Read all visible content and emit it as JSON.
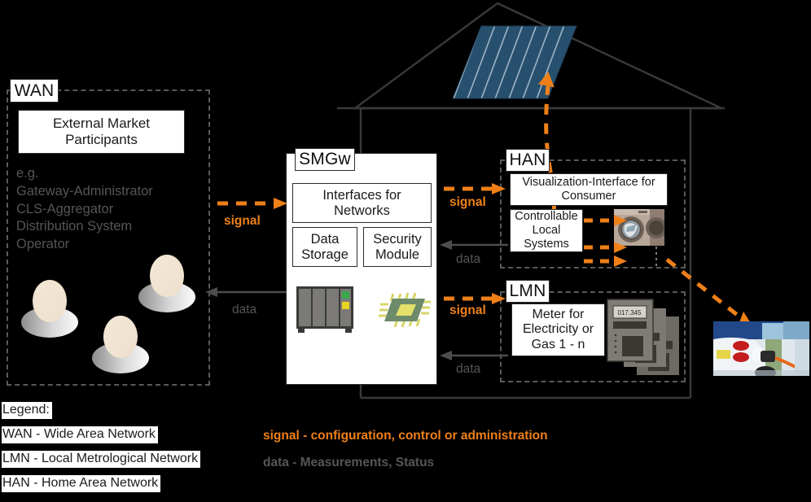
{
  "diagram": {
    "title": "Smart Meter Gateway Network Architecture",
    "colors": {
      "signal_orange": "#ef8018",
      "data_grey": "#575554",
      "background": "#000000",
      "box_fill": "#ffffff",
      "zone_dash": "#5a5a58",
      "solar_panel": "#27506e",
      "chip_body": "#6d8a6b",
      "chip_core": "#e4e06a",
      "server_body": "#7c7a78"
    }
  },
  "wan": {
    "tag": "WAN",
    "main_box": "External Market\nParticipants",
    "main_box_line1": "External Market",
    "main_box_line2": "Participants",
    "examples_lead": "e.g.",
    "examples": [
      "Gateway-Administrator",
      "CLS-Aggregator",
      "Distribution System",
      "Operator"
    ],
    "actors_icon": "person-group-icon"
  },
  "smgw": {
    "tag": "SMGw",
    "interfaces_line1": "Interfaces for",
    "interfaces_line2": "Networks",
    "data_storage_line1": "Data",
    "data_storage_line2": "Storage",
    "security_module_line1": "Security",
    "security_module_line2": "Module",
    "server_icon": "server-rack-icon",
    "chip_icon": "security-chip-icon"
  },
  "han": {
    "tag": "HAN",
    "visualization_line1": "Visualization-Interface for",
    "visualization_line2": "Consumer",
    "controllable_line1": "Controllable",
    "controllable_line2": "Local",
    "controllable_line3": "Systems",
    "appliance_icon": "washing-machine-photo"
  },
  "lmn": {
    "tag": "LMN",
    "meter_line1": "Meter for",
    "meter_line2": "Electricity or",
    "meter_line3": "Gas 1 - n",
    "meter_reading": "017.345",
    "meter_icon": "meter-stack-icon"
  },
  "house": {
    "solar_panel_icon": "solar-panel-icon",
    "ev_icon": "electric-vehicle-charging-photo"
  },
  "arrows": {
    "wan_to_smgw_signal": "signal",
    "smgw_to_wan_data": "data",
    "smgw_to_han_signal": "signal",
    "han_to_smgw_data": "data",
    "smgw_to_lmn_signal": "signal",
    "lmn_to_smgw_data": "data"
  },
  "legend": {
    "title": "Legend:",
    "entries": [
      "WAN - Wide Area Network",
      "LMN - Local Metrological Network",
      "HAN - Home Area Network"
    ]
  },
  "key": {
    "signal": "signal - configuration, control or administration",
    "data": "data - Measurements, Status"
  }
}
